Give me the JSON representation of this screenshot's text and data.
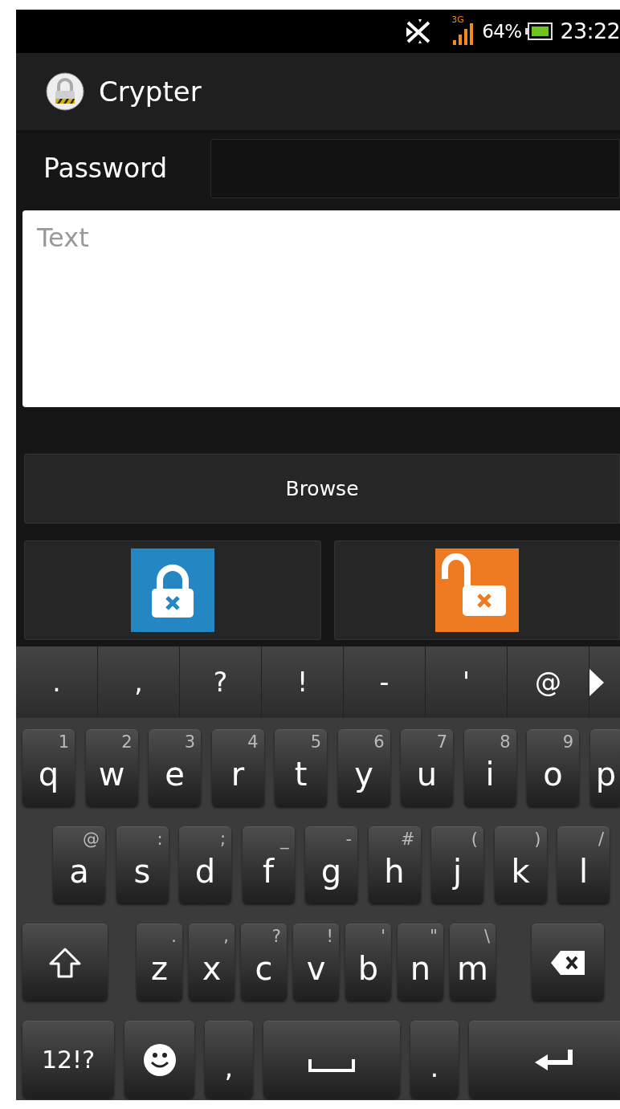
{
  "status_bar": {
    "network": "3G",
    "battery": "64%",
    "time": "23:22"
  },
  "app_bar": {
    "title": "Crypter"
  },
  "password": {
    "label": "Password"
  },
  "text_area": {
    "placeholder": "Text"
  },
  "browse_button": {
    "label": "Browse"
  },
  "action_buttons": [
    {
      "kind": "lock"
    },
    {
      "kind": "unlock"
    }
  ],
  "keyboard": {
    "suggestions": [
      ".",
      ",",
      "?",
      "!",
      "-",
      "'",
      "@"
    ],
    "rows": [
      {
        "keys": [
          {
            "kind": "letter",
            "label": "q",
            "hint": "1"
          },
          {
            "kind": "letter",
            "label": "w",
            "hint": "2"
          },
          {
            "kind": "letter",
            "label": "e",
            "hint": "3"
          },
          {
            "kind": "letter",
            "label": "r",
            "hint": "4"
          },
          {
            "kind": "letter",
            "label": "t",
            "hint": "5"
          },
          {
            "kind": "letter",
            "label": "y",
            "hint": "6"
          },
          {
            "kind": "letter",
            "label": "u",
            "hint": "7"
          },
          {
            "kind": "letter",
            "label": "i",
            "hint": "8"
          },
          {
            "kind": "letter",
            "label": "o",
            "hint": "9"
          },
          {
            "kind": "letter",
            "label": "p"
          }
        ]
      },
      {
        "keys": [
          {
            "kind": "letter",
            "label": "a",
            "hint": "@"
          },
          {
            "kind": "letter",
            "label": "s",
            "hint": ":"
          },
          {
            "kind": "letter",
            "label": "d",
            "hint": ";"
          },
          {
            "kind": "letter",
            "label": "f",
            "hint": "_"
          },
          {
            "kind": "letter",
            "label": "g",
            "hint": "-"
          },
          {
            "kind": "letter",
            "label": "h",
            "hint": "#"
          },
          {
            "kind": "letter",
            "label": "j",
            "hint": "("
          },
          {
            "kind": "letter",
            "label": "k",
            "hint": ")"
          },
          {
            "kind": "letter",
            "label": "l",
            "hint": "/"
          }
        ]
      },
      {
        "keys": [
          {
            "kind": "shift"
          },
          {
            "kind": "letter",
            "label": "z",
            "hint": "."
          },
          {
            "kind": "letter",
            "label": "x",
            "hint": ","
          },
          {
            "kind": "letter",
            "label": "c",
            "hint": "?"
          },
          {
            "kind": "letter",
            "label": "v",
            "hint": "!"
          },
          {
            "kind": "letter",
            "label": "b",
            "hint": "'"
          },
          {
            "kind": "letter",
            "label": "n",
            "hint": "\""
          },
          {
            "kind": "letter",
            "label": "m",
            "hint": "\\"
          },
          {
            "kind": "backspace"
          }
        ]
      },
      {
        "keys": [
          {
            "kind": "symbols",
            "label": "12!?"
          },
          {
            "kind": "emoji"
          },
          {
            "kind": "punct",
            "label": ","
          },
          {
            "kind": "space"
          },
          {
            "kind": "punct",
            "label": "."
          },
          {
            "kind": "enter"
          }
        ]
      }
    ]
  }
}
